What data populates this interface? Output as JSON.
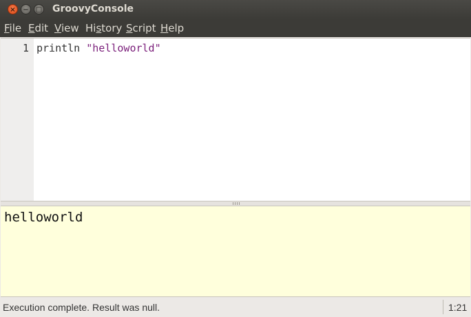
{
  "window": {
    "title": "GroovyConsole",
    "close_glyph": "×",
    "minimize_glyph": "−",
    "maximize_glyph": "□"
  },
  "menu": [
    {
      "mnemonic": "F",
      "rest": "ile"
    },
    {
      "mnemonic": "E",
      "rest": "dit"
    },
    {
      "mnemonic": "V",
      "rest": "iew"
    },
    {
      "pre": "Hi",
      "mnemonic": "s",
      "rest": "tory"
    },
    {
      "mnemonic": "S",
      "rest": "cript"
    },
    {
      "mnemonic": "H",
      "rest": "elp"
    }
  ],
  "editor": {
    "line_number": "1",
    "code_keyword": "println ",
    "code_string": "\"helloworld\""
  },
  "output": {
    "text": "helloworld"
  },
  "status": {
    "message": "Execution complete. Result was null.",
    "caret_position": "1:21"
  }
}
